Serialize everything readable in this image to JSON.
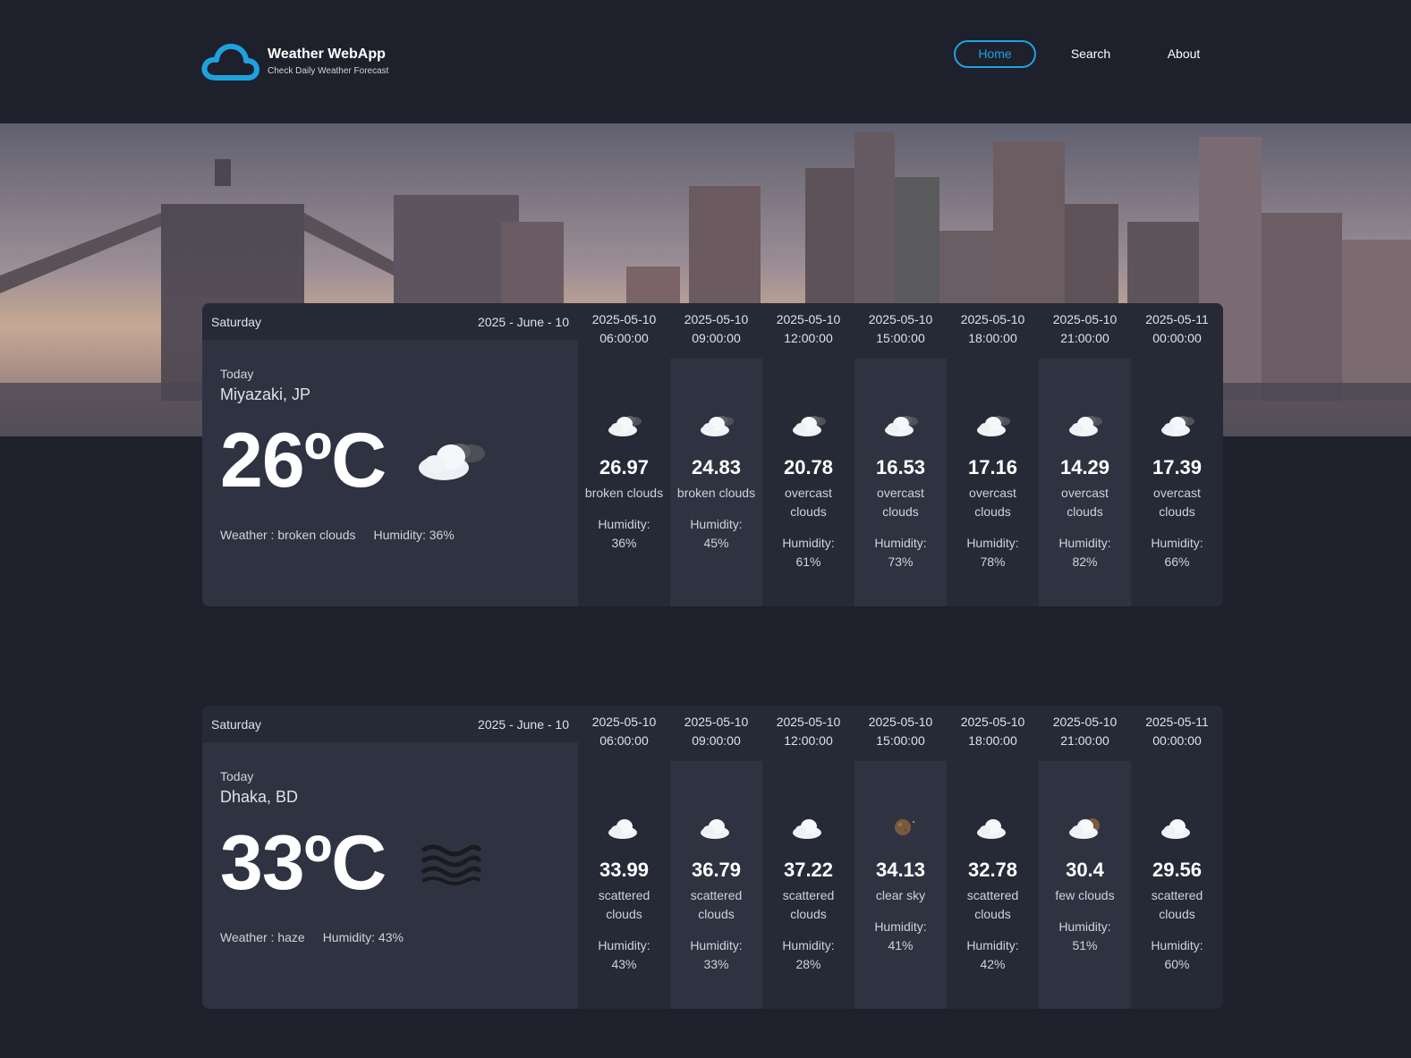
{
  "app": {
    "title": "Weather WebApp",
    "subtitle": "Check Daily Weather Forecast",
    "accent": "#1da2e0"
  },
  "nav": {
    "home": "Home",
    "search": "Search",
    "about": "About"
  },
  "cards": [
    {
      "day": "Saturday",
      "date": "2025 - June - 10",
      "today_label": "Today",
      "city": "Miyazaki, JP",
      "temp": "26ºC",
      "icon": "broken-clouds-icon",
      "weather": "Weather : broken clouds",
      "humidity": "Humidity: 36%",
      "forecast": [
        {
          "date": "2025-05-10",
          "time": "06:00:00",
          "icon": "broken-clouds-icon",
          "temp": "26.97",
          "desc": "broken clouds",
          "humidity_label": "Humidity:",
          "humidity": "36%"
        },
        {
          "date": "2025-05-10",
          "time": "09:00:00",
          "icon": "broken-clouds-icon",
          "temp": "24.83",
          "desc": "broken clouds",
          "humidity_label": "Humidity:",
          "humidity": "45%"
        },
        {
          "date": "2025-05-10",
          "time": "12:00:00",
          "icon": "overcast-clouds-icon",
          "temp": "20.78",
          "desc": "overcast clouds",
          "humidity_label": "Humidity:",
          "humidity": "61%"
        },
        {
          "date": "2025-05-10",
          "time": "15:00:00",
          "icon": "overcast-clouds-icon",
          "temp": "16.53",
          "desc": "overcast clouds",
          "humidity_label": "Humidity:",
          "humidity": "73%"
        },
        {
          "date": "2025-05-10",
          "time": "18:00:00",
          "icon": "overcast-clouds-icon",
          "temp": "17.16",
          "desc": "overcast clouds",
          "humidity_label": "Humidity:",
          "humidity": "78%"
        },
        {
          "date": "2025-05-10",
          "time": "21:00:00",
          "icon": "overcast-clouds-icon",
          "temp": "14.29",
          "desc": "overcast clouds",
          "humidity_label": "Humidity:",
          "humidity": "82%"
        },
        {
          "date": "2025-05-11",
          "time": "00:00:00",
          "icon": "overcast-clouds-icon",
          "temp": "17.39",
          "desc": "overcast clouds",
          "humidity_label": "Humidity:",
          "humidity": "66%"
        }
      ]
    },
    {
      "day": "Saturday",
      "date": "2025 - June - 10",
      "today_label": "Today",
      "city": "Dhaka, BD",
      "temp": "33ºC",
      "icon": "haze-icon",
      "weather": "Weather : haze",
      "humidity": "Humidity: 43%",
      "forecast": [
        {
          "date": "2025-05-10",
          "time": "06:00:00",
          "icon": "scattered-clouds-icon",
          "temp": "33.99",
          "desc": "scattered clouds",
          "humidity_label": "Humidity:",
          "humidity": "43%"
        },
        {
          "date": "2025-05-10",
          "time": "09:00:00",
          "icon": "scattered-clouds-icon",
          "temp": "36.79",
          "desc": "scattered clouds",
          "humidity_label": "Humidity:",
          "humidity": "33%"
        },
        {
          "date": "2025-05-10",
          "time": "12:00:00",
          "icon": "scattered-clouds-icon",
          "temp": "37.22",
          "desc": "scattered clouds",
          "humidity_label": "Humidity:",
          "humidity": "28%"
        },
        {
          "date": "2025-05-10",
          "time": "15:00:00",
          "icon": "clear-sky-night-icon",
          "temp": "34.13",
          "desc": "clear sky",
          "humidity_label": "Humidity:",
          "humidity": "41%"
        },
        {
          "date": "2025-05-10",
          "time": "18:00:00",
          "icon": "scattered-clouds-icon",
          "temp": "32.78",
          "desc": "scattered clouds",
          "humidity_label": "Humidity:",
          "humidity": "42%"
        },
        {
          "date": "2025-05-10",
          "time": "21:00:00",
          "icon": "few-clouds-night-icon",
          "temp": "30.4",
          "desc": "few clouds",
          "humidity_label": "Humidity:",
          "humidity": "51%"
        },
        {
          "date": "2025-05-11",
          "time": "00:00:00",
          "icon": "scattered-clouds-icon",
          "temp": "29.56",
          "desc": "scattered clouds",
          "humidity_label": "Humidity:",
          "humidity": "60%"
        }
      ]
    }
  ]
}
